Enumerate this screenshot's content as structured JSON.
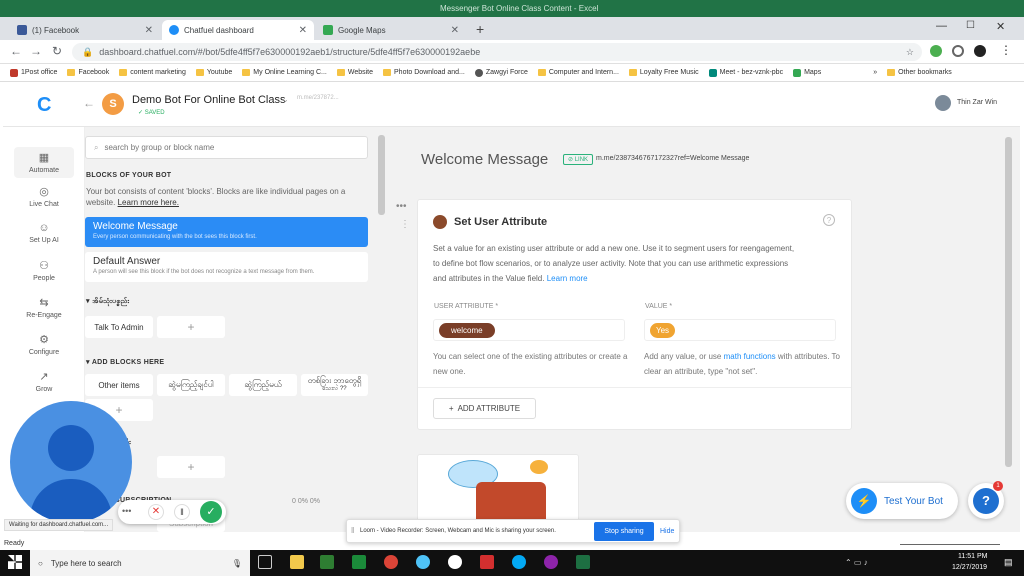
{
  "excel_title": "Messenger Bot Online Class Content - Excel",
  "tabs": [
    {
      "label": "(1) Facebook"
    },
    {
      "label": "Chatfuel dashboard"
    },
    {
      "label": "Google Maps"
    }
  ],
  "url": "dashboard.chatfuel.com/#/bot/5dfe4ff5f7e630000192aeb1/structure/5dfe4ff5f7e630000192aebe",
  "bookmarks": [
    "1Post office",
    "Facebook",
    "content marketing",
    "Youtube",
    "My Online Learning C...",
    "Website",
    "Photo Download and...",
    "Zawgyi Force",
    "Computer and Intern...",
    "Loyalty Free Music",
    "Meet - bez-vznk-pbc",
    "Maps"
  ],
  "other_bookmarks": "Other bookmarks",
  "bot": {
    "avatar_letter": "S",
    "name": "Demo Bot For Online Bot Class",
    "saved": "SAVED",
    "link": "m.me/237872..."
  },
  "user": {
    "name": "Thin Zar Win"
  },
  "nav": [
    {
      "label": "Automate"
    },
    {
      "label": "Live Chat"
    },
    {
      "label": "Set Up AI"
    },
    {
      "label": "People"
    },
    {
      "label": "Re-Engage"
    },
    {
      "label": "Configure"
    },
    {
      "label": "Grow"
    }
  ],
  "blocks": {
    "search_placeholder": "search by group or block name",
    "heading": "BLOCKS OF YOUR BOT",
    "desc": "Your bot consists of content 'blocks'. Blocks are like individual pages on a website.",
    "learn_more": "Learn more here.",
    "welcome": {
      "title": "Welcome Message",
      "sub": "Every person communicating with the bot sees this block first."
    },
    "default": {
      "title": "Default Answer",
      "sub": "A person will see this block if the bot does not recognize a text message from them."
    },
    "group1": "အိမ်သုံးပစ္စည်း",
    "talk": "Talk To Admin",
    "group2": "ADD BLOCKS HERE",
    "other": "Other items",
    "b1": "ဆွဲမကြည့်ချင်ပါ",
    "b2": "ဆွဲကြည့်မယ်",
    "b3": "တစ်ခြား ဘာတွေရှိ",
    "b3b": "သေးလဲ ??",
    "group3": "ဦး",
    "subs": "SUBSCRIPTION",
    "stats": "0  0%  0%",
    "subscription": "Subscription"
  },
  "main": {
    "title": "Welcome Message",
    "link_badge": "LINK",
    "link_url": "m.me/2387346767172327ref=Welcome Message",
    "card_title": "Set User Attribute",
    "card_desc_1": "Set a value for an existing user attribute or add a new one. Use it to segment users for reengagement,",
    "card_desc_2": "to define bot flow scenarios, or to analyze user activity. Note that you can use arithmetic expressions",
    "card_desc_3": "and attributes in the Value field.",
    "learn_more": "Learn more",
    "attr_label": "USER ATTRIBUTE *",
    "value_label": "VALUE *",
    "attr_value": "welcome",
    "value_value": "Yes",
    "attr_help": "You can select one of the existing attributes or create a new one.",
    "value_help_1": "Add any value, or use",
    "value_help_link": "math functions",
    "value_help_2": "with attributes. To clear an attribute, type \"not set\".",
    "add_attr": "ADD ATTRIBUTE",
    "test_bot": "Test Your Bot"
  },
  "status": {
    "waiting": "Waiting for dashboard.chatfuel.com...",
    "ready": "Ready"
  },
  "loom": {
    "text": "Loom - Video Recorder: Screen, Webcam and Mic is sharing your screen.",
    "stop": "Stop sharing",
    "hide": "Hide"
  },
  "taskbar": {
    "search": "Type here to search",
    "time": "11:51 PM",
    "date": "12/27/2019",
    "badge": "1"
  }
}
